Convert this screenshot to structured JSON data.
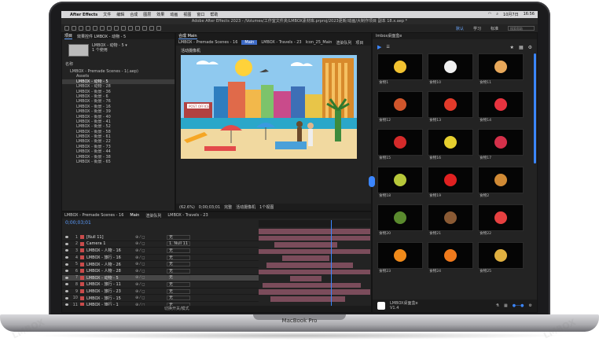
{
  "menubar": {
    "app_name": "After Effects",
    "items": [
      "文件",
      "编辑",
      "合成",
      "图层",
      "效果",
      "动画",
      "视图",
      "窗口",
      "帮助"
    ],
    "date": "10月7日",
    "time": "16:56"
  },
  "titlebar": {
    "text": "Adobe After Effects 2023 - /Volumes/工作室文件夹/LMBOX素材库.prproj/2023更新/动画/大制作项目 副本 18.x.aep *"
  },
  "toolbar": {
    "workspaces": [
      "默认",
      "学习",
      "标准"
    ],
    "selected_workspace": "默认",
    "search_placeholder": "搜索帮助"
  },
  "project_panel": {
    "tab_label": "项目",
    "tab2_label": "效果控件 LMBOX - 动物 - 5",
    "item_title": "LMBOX - 动物 - 5 ▾",
    "item_info": "1 个使用",
    "search_label": "名称",
    "tree": [
      "LMBOX - Premade Scenes - 1(.aep)",
      "Assets",
      "LMBOX - 动物 - 5",
      "LMBOX - 动物 - 28",
      "LMBOX - 街景 - 36",
      "LMBOX - 街景 - 6",
      "LMBOX - 街景 - 76",
      "LMBOX - 街景 - 16",
      "LMBOX - 街景 - 39",
      "LMBOX - 街景 - 40",
      "LMBOX - 街景 - 41",
      "LMBOX - 街景 - 52",
      "LMBOX - 街景 - 58",
      "LMBOX - 街景 - 61",
      "LMBOX - 街景 - 22",
      "LMBOX - 街景 - 73",
      "LMBOX - 街景 - 44",
      "LMBOX - 街景 - 38",
      "LMBOX - 街景 - 65"
    ],
    "selected_index": 2
  },
  "composition": {
    "header": "合成 Main",
    "tabs": [
      "LMBOX - Premade Scenes - 16",
      "Main",
      "LMBOX - Travels - 23",
      "Icon_25_Main",
      "渲染队列",
      "项目"
    ],
    "active_tab": "Main",
    "camera_label": "活动摄像机",
    "sign_text": "POST OFFICE",
    "footer": {
      "zoom": "(62.6%)",
      "timecode": "0;00;03;01",
      "quality": "完整",
      "camera": "活动摄像机",
      "views": "1个视图"
    }
  },
  "timeline": {
    "tabs": [
      "LMBOX - Premade Scenes - 16",
      "Main",
      "渲染队列",
      "LMBOX - Travels - 23"
    ],
    "active_tab": "Main",
    "timecode": "0;00;03;01",
    "footer_label": "切换开关/模式",
    "layers": [
      {
        "num": "1",
        "name": "[Null 11]",
        "parent": "无"
      },
      {
        "num": "2",
        "name": "Camera 1",
        "parent": "1. Null 11"
      },
      {
        "num": "3",
        "name": "LMBOX - 人物 - 16",
        "parent": "无"
      },
      {
        "num": "4",
        "name": "LMBOX - 旅行 - 16",
        "parent": "无"
      },
      {
        "num": "5",
        "name": "LMBOX - 人物 - 26",
        "parent": "无"
      },
      {
        "num": "6",
        "name": "LMBOX - 人物 - 28",
        "parent": "无"
      },
      {
        "num": "7",
        "name": "LMBOX - 动物 - 5",
        "parent": "无"
      },
      {
        "num": "8",
        "name": "LMBOX - 旅行 - 11",
        "parent": "无"
      },
      {
        "num": "9",
        "name": "LMBOX - 旅行 - 23",
        "parent": "无"
      },
      {
        "num": "10",
        "name": "LMBOX - 旅行 - 15",
        "parent": "无"
      },
      {
        "num": "11",
        "name": "LMBOX - 旅行 - 1",
        "parent": "无"
      }
    ],
    "selected_layer": 6
  },
  "library": {
    "header": "lmbox桌面盒e",
    "items": [
      {
        "label": "食物1",
        "icon": "fries-icon"
      },
      {
        "label": "食物10",
        "icon": "milk-icon"
      },
      {
        "label": "食物11",
        "icon": "icecream-icon"
      },
      {
        "label": "食物12",
        "icon": "sausage-icon"
      },
      {
        "label": "食物13",
        "icon": "tomato-icon"
      },
      {
        "label": "食物14",
        "icon": "strawberry-icon"
      },
      {
        "label": "食物15",
        "icon": "apple-icon"
      },
      {
        "label": "食物16",
        "icon": "pear-icon"
      },
      {
        "label": "食物17",
        "icon": "raspberry-icon"
      },
      {
        "label": "食物18",
        "icon": "lemon-icon"
      },
      {
        "label": "食物19",
        "icon": "chili-icon"
      },
      {
        "label": "食物2",
        "icon": "burger-icon"
      },
      {
        "label": "食物20",
        "icon": "avocado-icon"
      },
      {
        "label": "食物21",
        "icon": "coconut-icon"
      },
      {
        "label": "食物22",
        "icon": "drink-icon"
      },
      {
        "label": "食物23",
        "icon": "orange-icon"
      },
      {
        "label": "食物24",
        "icon": "carrot-icon"
      },
      {
        "label": "食物25",
        "icon": "candy-icon"
      }
    ],
    "footer_name": "LMBOX桌面盒e",
    "footer_version": "V1.4"
  },
  "laptop": {
    "brand": "MacBook Pro",
    "watermark": "LMBOX"
  },
  "colors": {
    "accent": "#3b86ff",
    "layer_label": "#c94b4b",
    "track_bar": "#7b4c5b"
  }
}
